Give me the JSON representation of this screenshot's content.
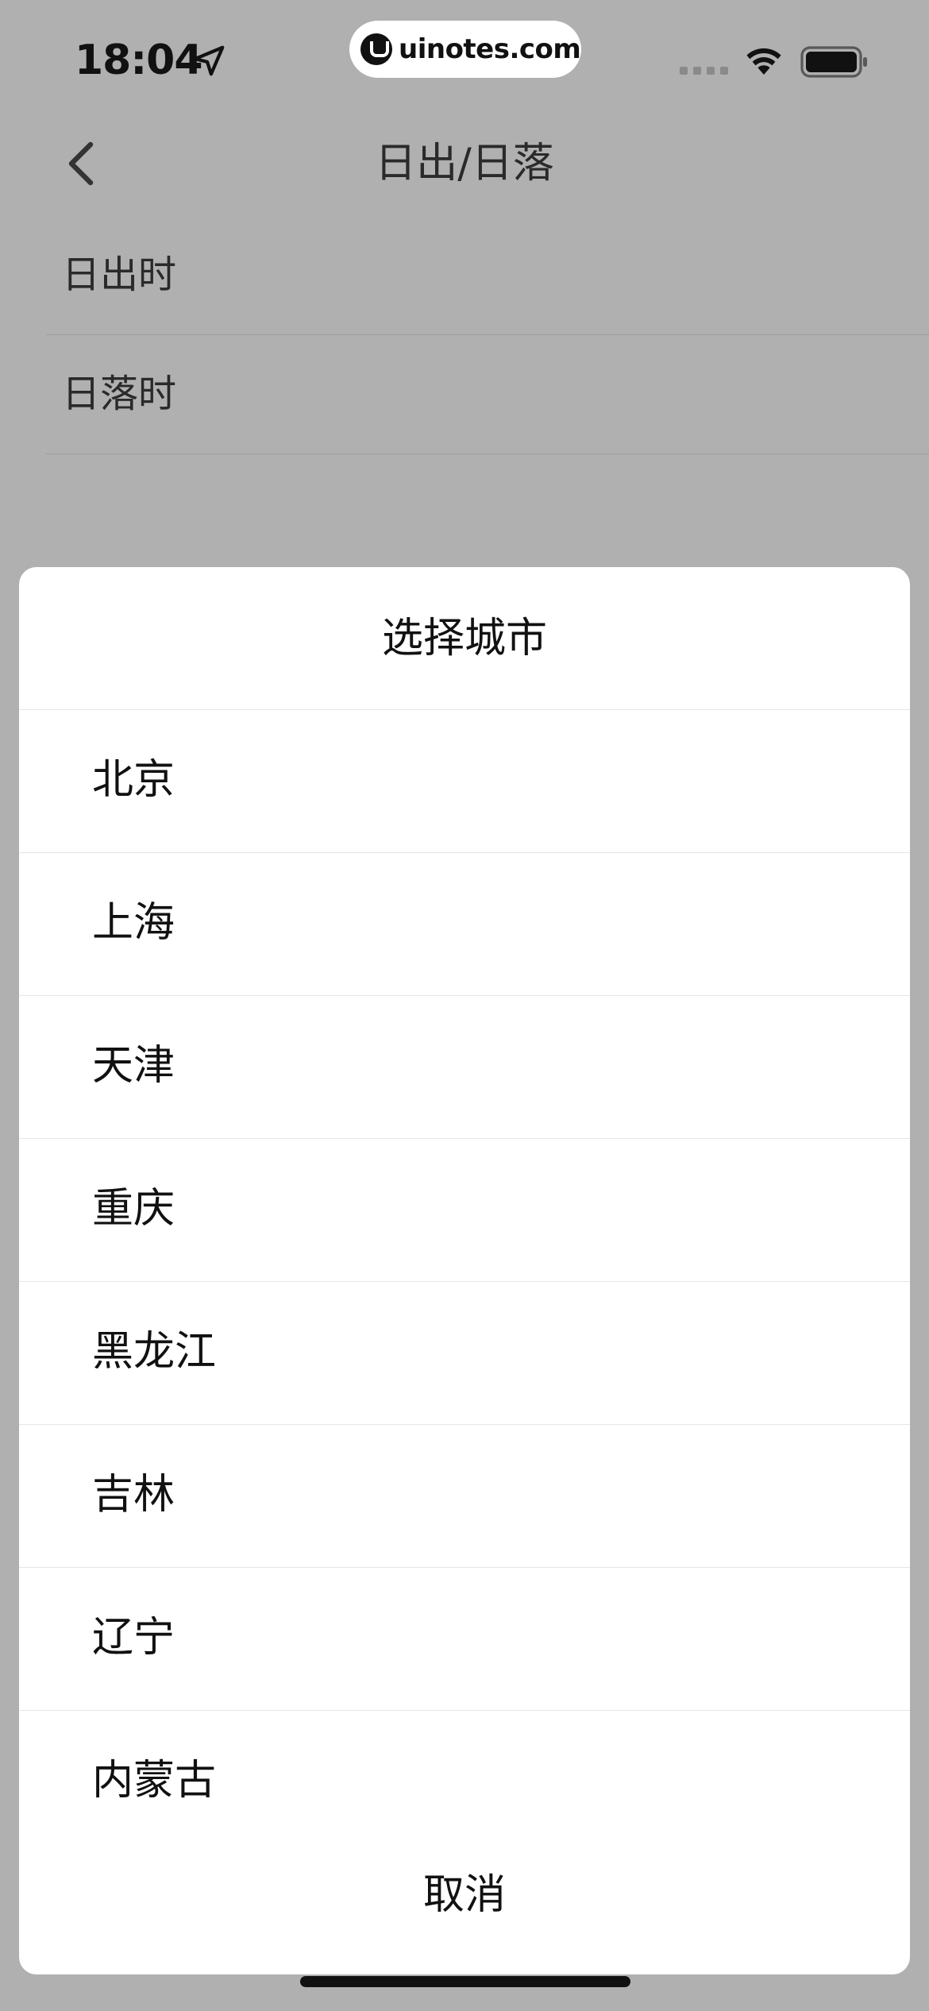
{
  "status_bar": {
    "time": "18:04",
    "badge_text": "uinotes.com"
  },
  "nav": {
    "title": "日出/日落"
  },
  "settings": {
    "rows": [
      {
        "label": "日出时"
      },
      {
        "label": "日落时"
      }
    ]
  },
  "sheet": {
    "title": "选择城市",
    "cities": [
      {
        "label": "北京"
      },
      {
        "label": "上海"
      },
      {
        "label": "天津"
      },
      {
        "label": "重庆"
      },
      {
        "label": "黑龙江"
      },
      {
        "label": "吉林"
      },
      {
        "label": "辽宁"
      },
      {
        "label": "内蒙古"
      }
    ],
    "cancel_label": "取消"
  },
  "colors": {
    "overlay_background": "#b0b0b0",
    "sheet_background": "#ffffff",
    "text": "#111111"
  }
}
